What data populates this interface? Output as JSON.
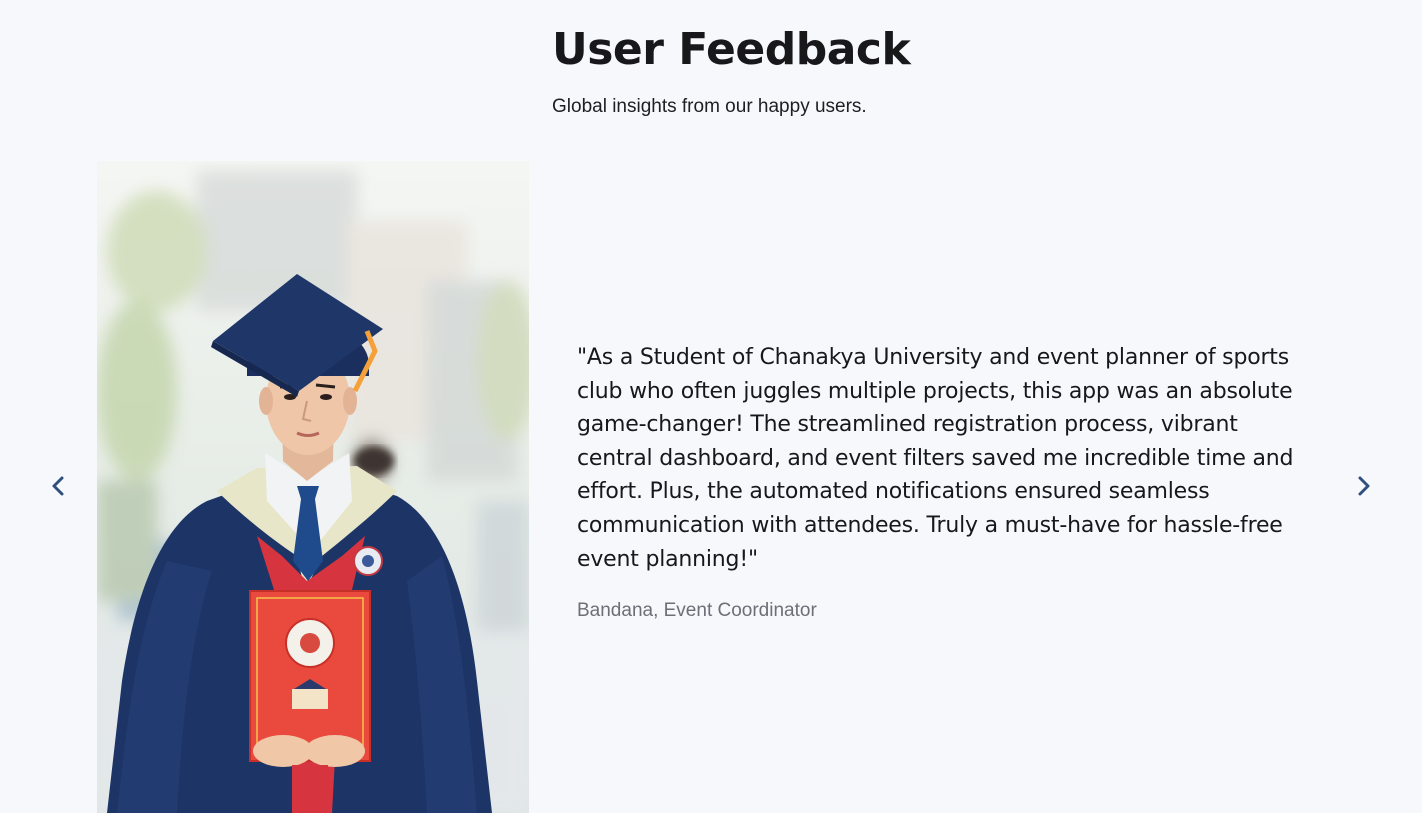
{
  "section": {
    "title": "User Feedback",
    "subtitle": "Global insights from our happy users."
  },
  "carousel": {
    "prev_icon": "chevron-left-icon",
    "next_icon": "chevron-right-icon",
    "arrow_color": "#2f4f7f",
    "slide": {
      "photo": "graduate-portrait",
      "quote": "\"As a Student of Chanakya University and event planner of sports club who often juggles multiple projects, this app was an absolute game-changer! The streamlined registration process, vibrant central dashboard, and event filters saved me incredible time and effort. Plus, the automated notifications ensured seamless communication with attendees. Truly a must-have for hassle-free event planning!\"",
      "author": "Bandana, Event Coordinator"
    }
  },
  "colors": {
    "background": "#f7f8fc",
    "title": "#18181b",
    "author_text": "#6b6f76",
    "gown_navy": "#1d3466",
    "sash_red": "#d6343f"
  }
}
